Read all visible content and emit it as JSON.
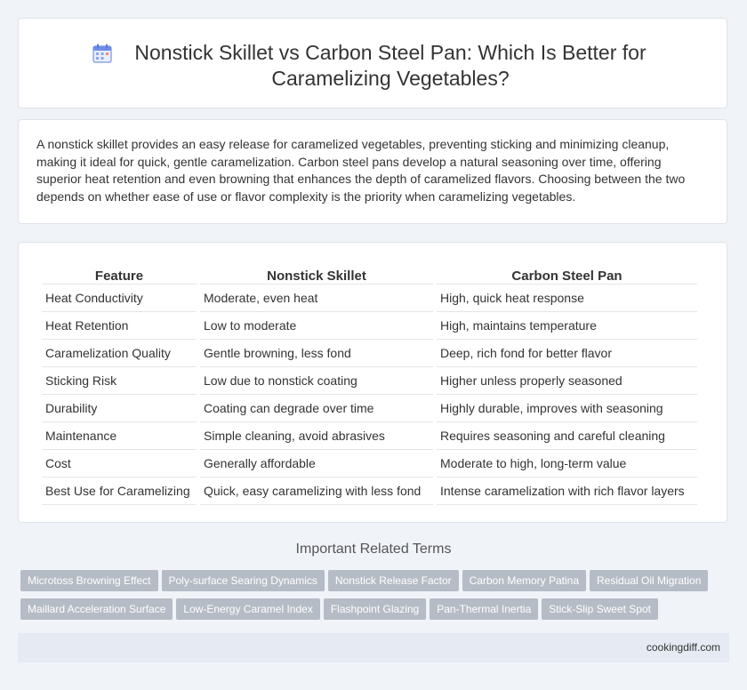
{
  "header": {
    "title": "Nonstick Skillet vs Carbon Steel Pan: Which Is Better for Caramelizing Vegetables?",
    "icon": "calendar-icon"
  },
  "summary": {
    "text": "A nonstick skillet provides an easy release for caramelized vegetables, preventing sticking and minimizing cleanup, making it ideal for quick, gentle caramelization. Carbon steel pans develop a natural seasoning over time, offering superior heat retention and even browning that enhances the depth of caramelized flavors. Choosing between the two depends on whether ease of use or flavor complexity is the priority when caramelizing vegetables."
  },
  "table": {
    "headers": [
      "Feature",
      "Nonstick Skillet",
      "Carbon Steel Pan"
    ],
    "rows": [
      [
        "Heat Conductivity",
        "Moderate, even heat",
        "High, quick heat response"
      ],
      [
        "Heat Retention",
        "Low to moderate",
        "High, maintains temperature"
      ],
      [
        "Caramelization Quality",
        "Gentle browning, less fond",
        "Deep, rich fond for better flavor"
      ],
      [
        "Sticking Risk",
        "Low due to nonstick coating",
        "Higher unless properly seasoned"
      ],
      [
        "Durability",
        "Coating can degrade over time",
        "Highly durable, improves with seasoning"
      ],
      [
        "Maintenance",
        "Simple cleaning, avoid abrasives",
        "Requires seasoning and careful cleaning"
      ],
      [
        "Cost",
        "Generally affordable",
        "Moderate to high, long-term value"
      ],
      [
        "Best Use for Caramelizing",
        "Quick, easy caramelizing with less fond",
        "Intense caramelization with rich flavor layers"
      ]
    ]
  },
  "related": {
    "title": "Important Related Terms",
    "tags": [
      "Microtoss Browning Effect",
      "Poly-surface Searing Dynamics",
      "Nonstick Release Factor",
      "Carbon Memory Patina",
      "Residual Oil Migration",
      "Maillard Acceleration Surface",
      "Low-Energy Caramel Index",
      "Flashpoint Glazing",
      "Pan-Thermal Inertia",
      "Stick-Slip Sweet Spot"
    ]
  },
  "footer": {
    "site": "cookingdiff.com"
  }
}
